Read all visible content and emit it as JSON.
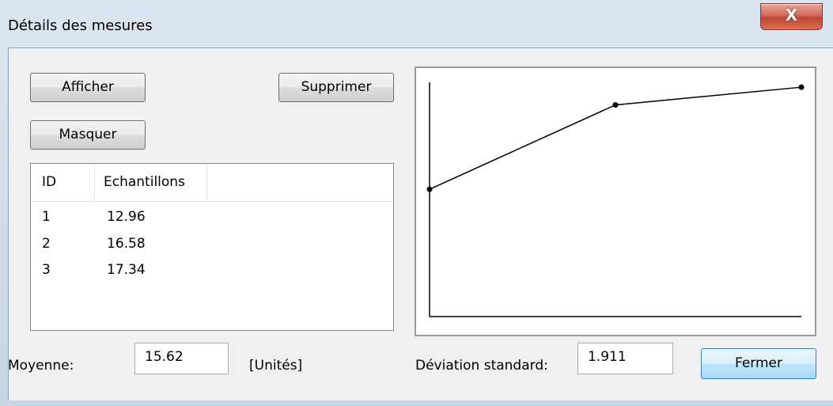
{
  "window": {
    "title": "Détails des mesures",
    "close_label": "X"
  },
  "buttons": {
    "show": "Afficher",
    "delete": "Supprimer",
    "hide": "Masquer",
    "close": "Fermer"
  },
  "table": {
    "columns": [
      "ID",
      "Echantillons",
      ""
    ],
    "rows": [
      {
        "id": "1",
        "value": "12.96"
      },
      {
        "id": "2",
        "value": "16.58"
      },
      {
        "id": "3",
        "value": "17.34"
      }
    ]
  },
  "footer": {
    "mean_label": "Moyenne:",
    "mean_value": "15.62",
    "unit_label": "[Unités]",
    "stddev_label": "Déviation standard:",
    "stddev_value": "1.911"
  },
  "chart_data": {
    "type": "line",
    "x": [
      1,
      2,
      3
    ],
    "values": [
      12.96,
      16.58,
      17.34
    ],
    "title": "",
    "xlabel": "",
    "ylabel": "",
    "ylim": [
      7.5,
      17.55
    ],
    "grid": false
  },
  "colors": {
    "line": "#000000",
    "default_button_border": "#3c7fb1"
  }
}
